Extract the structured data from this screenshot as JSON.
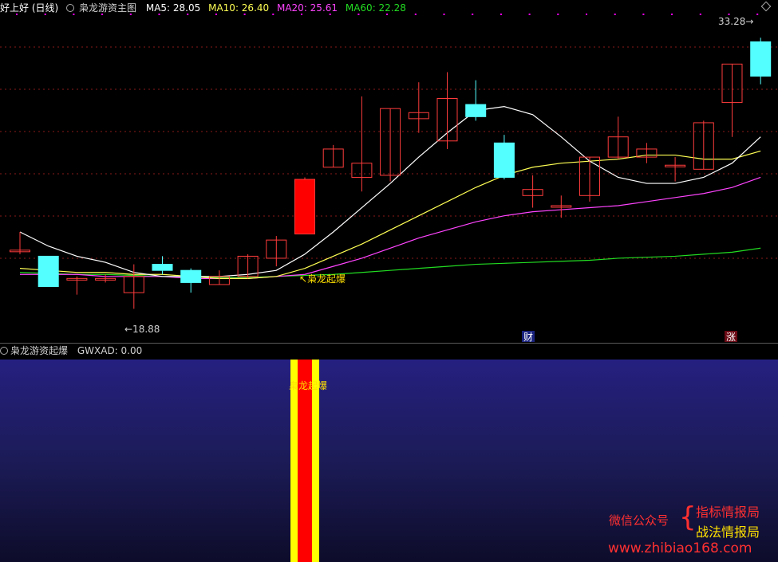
{
  "header": {
    "title": "好上好 (日线)",
    "study": "枭龙游资主图",
    "ma5": "MA5: 28.05",
    "ma10": "MA10: 26.40",
    "ma20": "MA20: 25.61",
    "ma60": "MA60: 22.28"
  },
  "chart": {
    "high_label": "33.28",
    "low_label": "18.88",
    "signal_label": "枭龙起爆",
    "marker_cai": "财",
    "marker_zhang": "涨",
    "colors": {
      "up": "#ff3c3c",
      "down": "#54ffff",
      "ma5": "#ffffff",
      "ma10": "#ffff55",
      "ma20": "#ff44ff",
      "ma60": "#22dd22"
    },
    "candles": [
      {
        "o": 22.7,
        "c": 22.7,
        "h": 23.6,
        "l": 22.5
      },
      {
        "o": 22.4,
        "c": 20.9,
        "h": 22.4,
        "l": 20.9
      },
      {
        "o": 21.3,
        "c": 21.3,
        "h": 21.4,
        "l": 20.5
      },
      {
        "o": 21.3,
        "c": 21.3,
        "h": 21.5,
        "l": 21.1
      },
      {
        "o": 20.6,
        "c": 21.4,
        "h": 22.0,
        "l": 19.8
      },
      {
        "o": 22.0,
        "c": 21.7,
        "h": 22.4,
        "l": 21.5
      },
      {
        "o": 21.7,
        "c": 21.1,
        "h": 21.8,
        "l": 20.6
      },
      {
        "o": 21.0,
        "c": 21.4,
        "h": 21.7,
        "l": 21.0
      },
      {
        "o": 21.4,
        "c": 22.4,
        "h": 22.5,
        "l": 21.3
      },
      {
        "o": 22.3,
        "c": 23.2,
        "h": 23.4,
        "l": 21.9
      },
      {
        "o": 23.5,
        "c": 26.2,
        "h": 26.3,
        "l": 23.5
      },
      {
        "o": 26.8,
        "c": 27.7,
        "h": 27.9,
        "l": 26.8
      },
      {
        "o": 26.3,
        "c": 27.0,
        "h": 30.3,
        "l": 25.6
      },
      {
        "o": 26.4,
        "c": 29.7,
        "h": 29.7,
        "l": 26.1
      },
      {
        "o": 29.2,
        "c": 29.5,
        "h": 31.0,
        "l": 28.5
      },
      {
        "o": 28.1,
        "c": 30.2,
        "h": 31.5,
        "l": 27.7
      },
      {
        "o": 29.9,
        "c": 29.3,
        "h": 31.1,
        "l": 29.1
      },
      {
        "o": 28.0,
        "c": 26.3,
        "h": 28.4,
        "l": 26.2
      },
      {
        "o": 25.4,
        "c": 25.7,
        "h": 26.4,
        "l": 24.8
      },
      {
        "o": 24.9,
        "c": 24.9,
        "h": 25.4,
        "l": 24.3
      },
      {
        "o": 25.4,
        "c": 27.3,
        "h": 27.3,
        "l": 25.1
      },
      {
        "o": 27.3,
        "c": 28.3,
        "h": 29.3,
        "l": 27.2
      },
      {
        "o": 27.3,
        "c": 27.7,
        "h": 28.0,
        "l": 27.0
      },
      {
        "o": 26.9,
        "c": 26.9,
        "h": 27.3,
        "l": 26.1
      },
      {
        "o": 26.7,
        "c": 29.0,
        "h": 29.1,
        "l": 26.7
      },
      {
        "o": 30.0,
        "c": 31.9,
        "h": 31.9,
        "l": 28.3
      },
      {
        "o": 33.0,
        "c": 31.3,
        "h": 33.2,
        "l": 30.9
      }
    ],
    "ma5_values": [
      23.6,
      22.9,
      22.4,
      22.1,
      21.6,
      21.4,
      21.4,
      21.4,
      21.5,
      21.7,
      22.5,
      23.6,
      24.8,
      26.0,
      27.3,
      28.5,
      29.6,
      29.8,
      29.4,
      28.3,
      27.1,
      26.3,
      26.0,
      26.0,
      26.3,
      27.0,
      28.3
    ],
    "ma10_values": [
      21.8,
      21.7,
      21.6,
      21.6,
      21.5,
      21.5,
      21.4,
      21.3,
      21.3,
      21.4,
      21.8,
      22.4,
      23.0,
      23.7,
      24.4,
      25.1,
      25.8,
      26.4,
      26.8,
      27.0,
      27.1,
      27.2,
      27.4,
      27.4,
      27.2,
      27.2,
      27.6
    ],
    "ma20_values": [
      21.5,
      21.5,
      21.5,
      21.4,
      21.4,
      21.4,
      21.3,
      21.3,
      21.3,
      21.4,
      21.5,
      21.9,
      22.3,
      22.8,
      23.3,
      23.7,
      24.1,
      24.4,
      24.6,
      24.7,
      24.8,
      24.9,
      25.1,
      25.3,
      25.5,
      25.8,
      26.3
    ],
    "ma60_values": [
      21.6,
      21.55,
      21.5,
      21.5,
      21.45,
      21.4,
      21.4,
      21.35,
      21.35,
      21.4,
      21.45,
      21.5,
      21.6,
      21.7,
      21.8,
      21.9,
      22.0,
      22.05,
      22.1,
      22.15,
      22.2,
      22.3,
      22.35,
      22.4,
      22.5,
      22.6,
      22.8
    ]
  },
  "lower": {
    "study": "枭龙游资起爆",
    "gwxad": "GWXAD: 0.00",
    "signal_label": "枭龙起爆",
    "bar_index": 10
  },
  "watermark": {
    "left": "微信公众号",
    "right1": "指标情报局",
    "right2": "战法情报局",
    "url": "www.zhibiao168.com"
  }
}
